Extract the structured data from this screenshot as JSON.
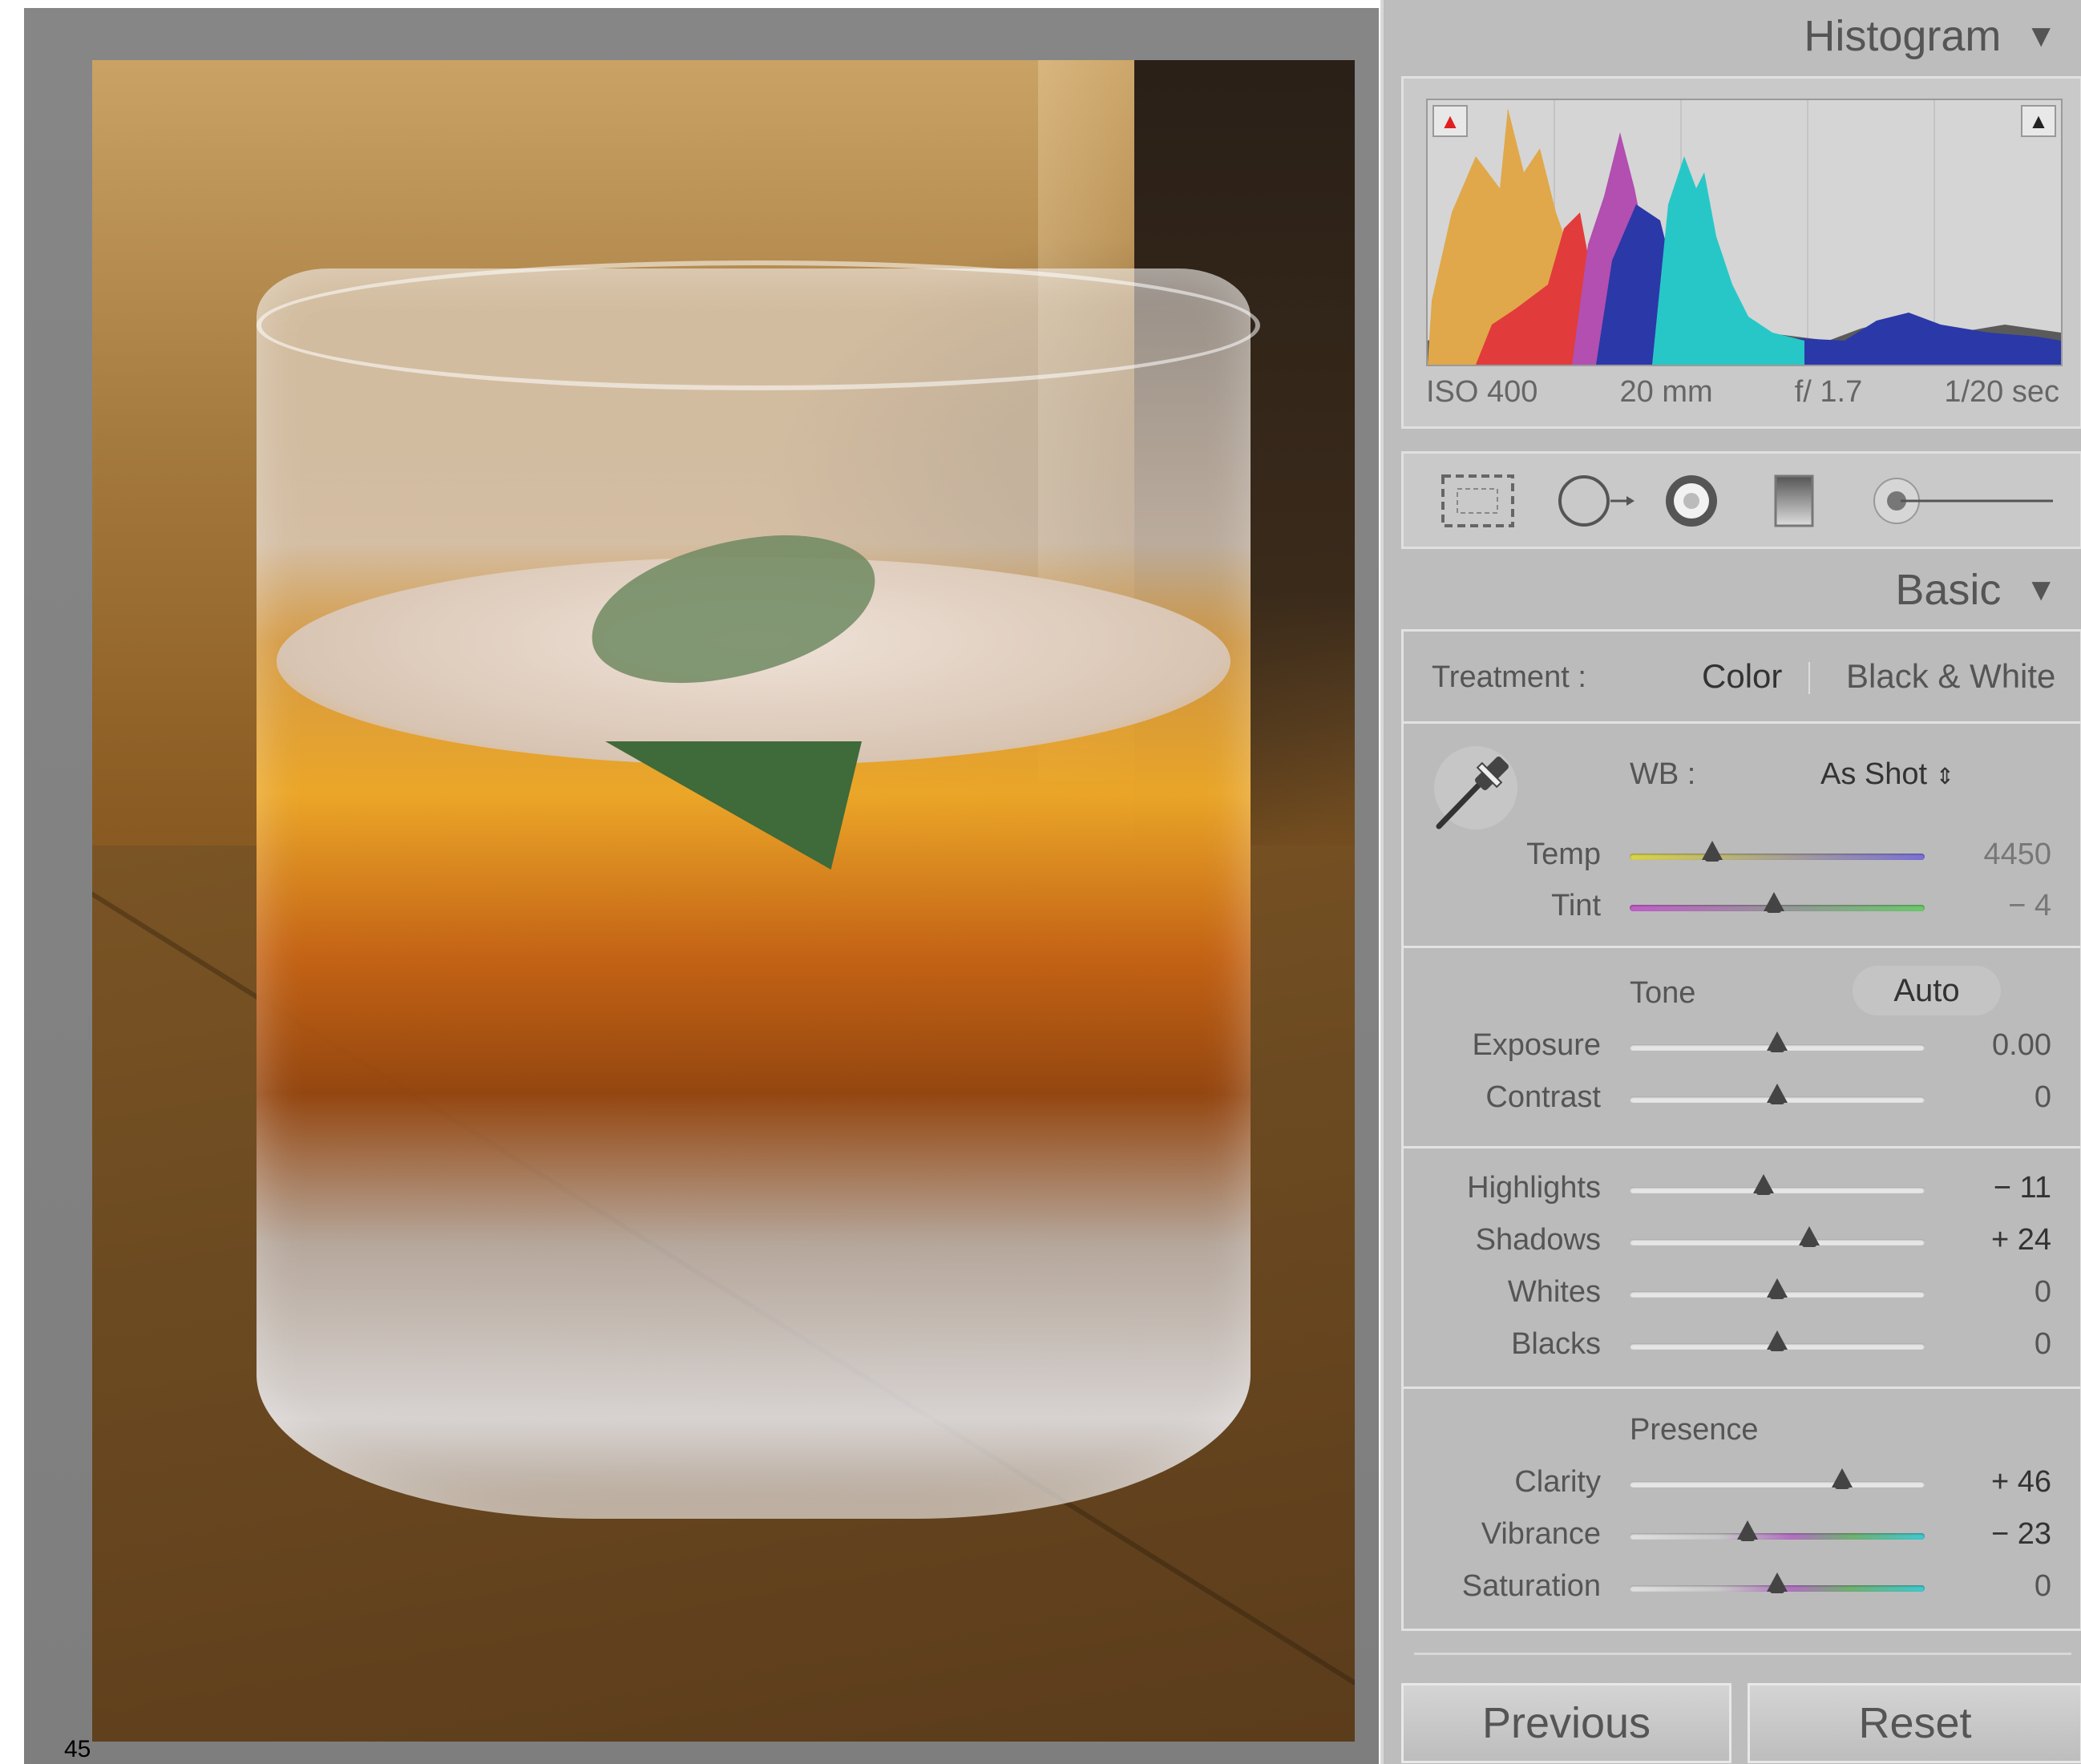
{
  "photo": {
    "caption": "45"
  },
  "panel": {
    "histogram": {
      "title": "Histogram",
      "exif": {
        "iso": "ISO 400",
        "focal": "20 mm",
        "aperture": "f/ 1.7",
        "shutter": "1/20 sec"
      }
    },
    "tools": [
      "crop-overlay-icon",
      "spot-removal-icon",
      "red-eye-icon",
      "graduated-filter-icon",
      "adjustment-brush-icon"
    ],
    "basic": {
      "title": "Basic",
      "treatment": {
        "label": "Treatment :",
        "color": "Color",
        "bw": "Black & White"
      },
      "wb": {
        "label": "WB :",
        "value": "As Shot"
      },
      "temp": {
        "label": "Temp",
        "value": "4450",
        "level": 0.28
      },
      "tint": {
        "label": "Tint",
        "value": "− 4",
        "level": 0.49
      },
      "tone": {
        "label": "Tone",
        "auto": "Auto"
      },
      "exposure": {
        "label": "Exposure",
        "value": "0.00",
        "level": 0.5
      },
      "contrast": {
        "label": "Contrast",
        "value": "0",
        "level": 0.5
      },
      "highlights": {
        "label": "Highlights",
        "value": "− 11",
        "level": 0.455
      },
      "shadows": {
        "label": "Shadows",
        "value": "+ 24",
        "level": 0.61
      },
      "whites": {
        "label": "Whites",
        "value": "0",
        "level": 0.5
      },
      "blacks": {
        "label": "Blacks",
        "value": "0",
        "level": 0.5
      },
      "presence": {
        "label": "Presence"
      },
      "clarity": {
        "label": "Clarity",
        "value": "+ 46",
        "level": 0.72
      },
      "vibrance": {
        "label": "Vibrance",
        "value": "− 23",
        "level": 0.4
      },
      "saturation": {
        "label": "Saturation",
        "value": "0",
        "level": 0.5
      }
    },
    "buttons": {
      "previous": "Previous",
      "reset": "Reset"
    },
    "colors": {
      "panel_bg": "#bdbdbd",
      "text": "#555555"
    }
  }
}
